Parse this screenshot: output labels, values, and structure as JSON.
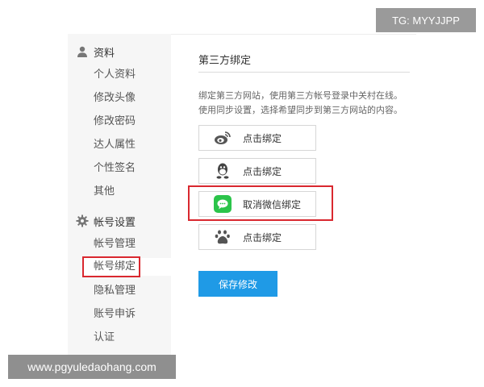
{
  "sidebar": {
    "groups": [
      {
        "title": "资料",
        "icon": "user-icon",
        "items": [
          {
            "label": "个人资料"
          },
          {
            "label": "修改头像"
          },
          {
            "label": "修改密码"
          },
          {
            "label": "达人属性"
          },
          {
            "label": "个性签名"
          },
          {
            "label": "其他"
          }
        ]
      },
      {
        "title": "帐号设置",
        "icon": "gear-icon",
        "items": [
          {
            "label": "帐号管理"
          },
          {
            "label": "帐号绑定",
            "active": true
          },
          {
            "label": "隐私管理"
          },
          {
            "label": "账号申诉"
          },
          {
            "label": "认证"
          }
        ]
      }
    ]
  },
  "main": {
    "section_title": "第三方绑定",
    "description": [
      "绑定第三方网站，使用第三方帐号登录中关村在线。",
      "使用同步设置，选择希望同步到第三方网站的内容。"
    ],
    "bindings": [
      {
        "service_icon": "weibo-icon",
        "label": "点击绑定"
      },
      {
        "service_icon": "qq-icon",
        "label": "点击绑定"
      },
      {
        "service_icon": "wechat-icon",
        "label": "取消微信绑定",
        "highlight_color": "#d9282f"
      },
      {
        "service_icon": "baidu-icon",
        "label": "点击绑定"
      }
    ],
    "save_label": "保存修改",
    "save_color": "#1f9ae6"
  },
  "watermarks": {
    "top_right": "TG: MYYJJPP",
    "bottom_left": "www.pgyuledaohang.com"
  }
}
